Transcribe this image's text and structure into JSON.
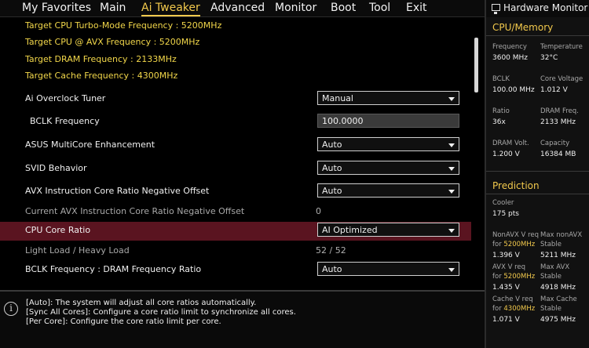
{
  "menu": {
    "items": [
      "My Favorites",
      "Main",
      "Ai Tweaker",
      "Advanced",
      "Monitor",
      "Boot",
      "Tool",
      "Exit"
    ],
    "active_index": 2
  },
  "info_lines": [
    "Target CPU Turbo-Mode Frequency : 5200MHz",
    "Target CPU @ AVX Frequency : 5200MHz",
    "Target DRAM Frequency : 2133MHz",
    "Target Cache Frequency : 4300MHz"
  ],
  "settings": {
    "ai_overclock_tuner": {
      "label": "Ai Overclock Tuner",
      "value": "Manual"
    },
    "bclk_frequency": {
      "label": "BCLK Frequency",
      "value": "100.0000"
    },
    "multicore": {
      "label": "ASUS MultiCore Enhancement",
      "value": "Auto"
    },
    "svid": {
      "label": "SVID Behavior",
      "value": "Auto"
    },
    "avx_offset": {
      "label": "AVX Instruction Core Ratio Negative Offset",
      "value": "Auto"
    },
    "current_avx_offset": {
      "label": "Current AVX Instruction Core Ratio Negative Offset",
      "value": "0"
    },
    "cpu_core_ratio": {
      "label": "CPU Core Ratio",
      "value": "AI Optimized"
    },
    "light_heavy_load": {
      "label": "Light Load / Heavy Load",
      "value": "52 / 52"
    },
    "bclk_dram_ratio": {
      "label": "BCLK Frequency : DRAM Frequency Ratio",
      "value": "Auto"
    }
  },
  "help": {
    "lines": [
      "[Auto]: The system will adjust all core ratios automatically.",
      "[Sync All Cores]: Configure a core ratio limit to synchronize all cores.",
      "[Per Core]: Configure the core ratio limit per core."
    ],
    "icon": "info-icon"
  },
  "hardware_monitor": {
    "title": "Hardware Monitor",
    "cpu_memory": {
      "title": "CPU/Memory",
      "frequency": {
        "label": "Frequency",
        "value": "3600 MHz"
      },
      "temperature": {
        "label": "Temperature",
        "value": "32°C"
      },
      "bclk": {
        "label": "BCLK",
        "value": "100.00 MHz"
      },
      "core_voltage": {
        "label": "Core Voltage",
        "value": "1.012 V"
      },
      "ratio": {
        "label": "Ratio",
        "value": "36x"
      },
      "dram_freq": {
        "label": "DRAM Freq.",
        "value": "2133 MHz"
      },
      "dram_volt": {
        "label": "DRAM Volt.",
        "value": "1.200 V"
      },
      "capacity": {
        "label": "Capacity",
        "value": "16384 MB"
      }
    },
    "prediction": {
      "title": "Prediction",
      "cooler": {
        "label": "Cooler",
        "value": "175 pts"
      },
      "nonavx_req": {
        "label1": "NonAVX V req",
        "label2": "for",
        "freq": "5200MHz",
        "value": "1.396 V"
      },
      "max_nonavx": {
        "label1": "Max nonAVX",
        "label2": "Stable",
        "value": "5211 MHz"
      },
      "avx_req": {
        "label1": "AVX V req",
        "label2": "for",
        "freq": "5200MHz",
        "value": "1.435 V"
      },
      "max_avx": {
        "label1": "Max AVX",
        "label2": "Stable",
        "value": "4918 MHz"
      },
      "cache_req": {
        "label1": "Cache V req",
        "label2": "for",
        "freq": "4300MHz",
        "value": "1.071 V"
      },
      "max_cache": {
        "label1": "Max Cache",
        "label2": "Stable",
        "value": "4975 MHz"
      }
    }
  },
  "colors": {
    "accent": "#f2c94c",
    "highlight_row": "#5a1420",
    "background": "#000000",
    "monitor_bg": "#111111"
  }
}
